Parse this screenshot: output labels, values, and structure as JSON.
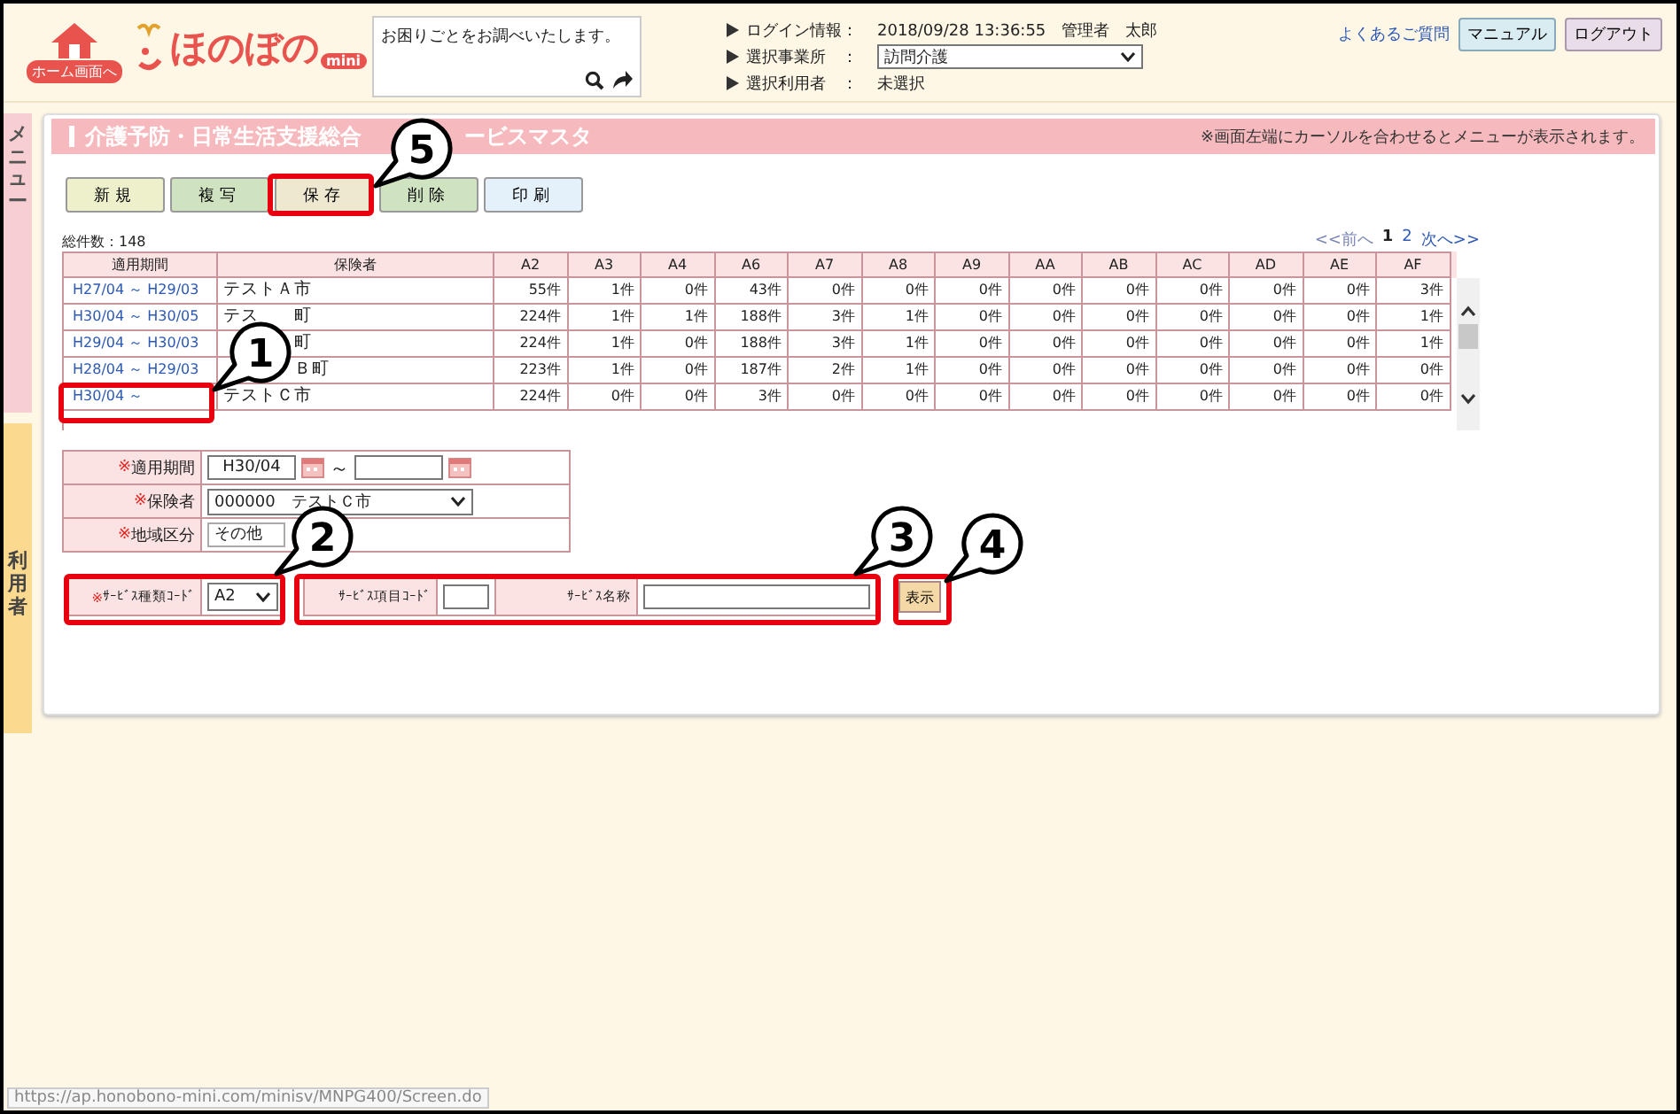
{
  "header": {
    "home_label": "ホーム画面へ",
    "logo_text": "ほのぼの",
    "logo_badge": "mini",
    "help_search": {
      "value": "お困りごとをお調べいたします。"
    },
    "info": [
      {
        "label": "ログイン情報：",
        "kind": "text",
        "value": "2018/09/28 13:36:55　管理者　太郎"
      },
      {
        "label": "選択事業所　：",
        "kind": "select",
        "value": "訪問介護"
      },
      {
        "label": "選択利用者　：",
        "kind": "text",
        "value": "未選択"
      }
    ],
    "faq_link": "よくあるご質問",
    "buttons": [
      {
        "label": "マニュアル",
        "kind": "manual"
      },
      {
        "label": "ログアウト",
        "kind": "logout"
      }
    ]
  },
  "side_tabs": [
    {
      "label": "メニュー",
      "kind": "menu"
    },
    {
      "label": "利用者",
      "kind": "user"
    }
  ],
  "page": {
    "title_parts": [
      "介護予防・日常生活支援総合",
      "ービスマスタ"
    ],
    "notice": "※画面左端にカーソルを合わせるとメニューが表示されます。",
    "toolbar": [
      {
        "label": "新規",
        "kind": "new"
      },
      {
        "label": "複写",
        "kind": "green"
      },
      {
        "label": "保存",
        "kind": "save"
      },
      {
        "label": "削除",
        "kind": "green"
      },
      {
        "label": "印刷",
        "kind": "print"
      }
    ],
    "total": "総件数：148",
    "pager": [
      {
        "label": "<<前へ",
        "kind": "text"
      },
      {
        "label": "1",
        "kind": "page",
        "selected": true
      },
      {
        "label": "2",
        "kind": "page",
        "selected": false
      },
      {
        "label": "次へ>>",
        "kind": "link"
      }
    ],
    "table": {
      "columns": [
        "適用期間",
        "保険者",
        "A2",
        "A3",
        "A4",
        "A6",
        "A7",
        "A8",
        "A9",
        "AA",
        "AB",
        "AC",
        "AD",
        "AE",
        "AF"
      ],
      "rows": [
        {
          "period": "H27/04 ～ H29/03",
          "insurer": {
            "start": "テストＡ市"
          },
          "counts": [
            "55件",
            "1件",
            "0件",
            "43件",
            "0件",
            "0件",
            "0件",
            "0件",
            "0件",
            "0件",
            "0件",
            "0件",
            "3件"
          ]
        },
        {
          "period": "H30/04 ～ H30/05",
          "insurer": {
            "start": "テス",
            "end": "町"
          },
          "counts": [
            "224件",
            "1件",
            "1件",
            "188件",
            "3件",
            "1件",
            "0件",
            "0件",
            "0件",
            "0件",
            "0件",
            "0件",
            "1件"
          ]
        },
        {
          "period": "H29/04 ～ H30/03",
          "insurer": {
            "end": "町"
          },
          "counts": [
            "224件",
            "1件",
            "0件",
            "188件",
            "3件",
            "1件",
            "0件",
            "0件",
            "0件",
            "0件",
            "0件",
            "0件",
            "1件"
          ]
        },
        {
          "period": "H28/04 ～ H29/03",
          "insurer": {
            "end": "Ｂ町"
          },
          "counts": [
            "223件",
            "1件",
            "0件",
            "187件",
            "2件",
            "1件",
            "0件",
            "0件",
            "0件",
            "0件",
            "0件",
            "0件",
            "0件"
          ]
        },
        {
          "period": "H30/04 ～",
          "insurer": {
            "start": "テストＣ市"
          },
          "counts": [
            "224件",
            "0件",
            "0件",
            "3件",
            "0件",
            "0件",
            "0件",
            "0件",
            "0件",
            "0件",
            "0件",
            "0件",
            "0件"
          ]
        }
      ]
    },
    "form": [
      {
        "mark": "※",
        "label": "適用期間",
        "kind": "period",
        "from": "H30/04",
        "separator": "～"
      },
      {
        "mark": "※",
        "label": "保険者",
        "kind": "select",
        "value": "000000　テストＣ市"
      },
      {
        "mark": "※",
        "label": "地域区分",
        "kind": "text",
        "value": "その他"
      }
    ],
    "search": {
      "type_code": {
        "mark": "※",
        "label": "ｻｰﾋﾞｽ種類ｺｰﾄﾞ",
        "value": "A2"
      },
      "item_code": {
        "label": "ｻｰﾋﾞｽ項目ｺｰﾄﾞ"
      },
      "name": {
        "label": "ｻｰﾋﾞｽ名称"
      },
      "button": "表示"
    }
  },
  "annotations": [
    {
      "number": "5"
    },
    {
      "number": "1"
    },
    {
      "number": "2"
    },
    {
      "number": "3"
    },
    {
      "number": "4"
    }
  ],
  "status_bar": "https://ap.honobono-mini.com/minisv/MNPG400/Screen.do"
}
